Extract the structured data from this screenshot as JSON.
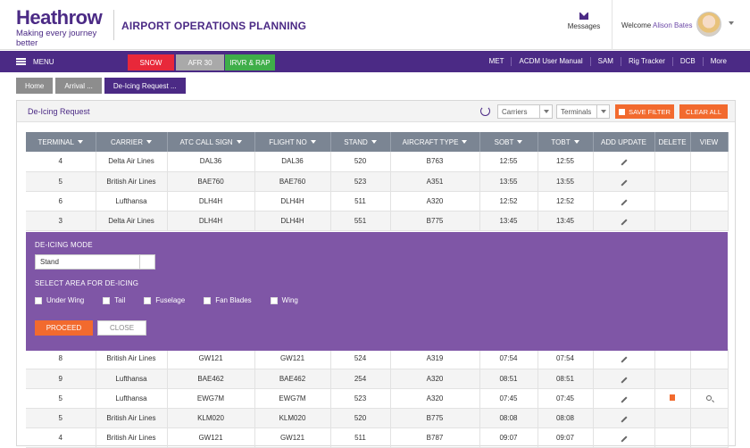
{
  "header": {
    "logo_main": "Heathrow",
    "logo_tagline": "Making every journey better",
    "app_title": "AIRPORT OPERATIONS PLANNING",
    "messages_label": "Messages",
    "welcome_prefix": "Welcome",
    "user_name": "Alison Bates"
  },
  "navbar": {
    "menu_label": "MENU",
    "pills": {
      "snow": "SNOW",
      "afr": "AFR 30",
      "irvr": "IRVR & RAP"
    },
    "links": [
      "MET",
      "ACDM User Manual",
      "SAM",
      "Rig Tracker",
      "DCB",
      "More"
    ]
  },
  "breadcrumb": [
    "Home",
    "Arrival ...",
    "De-Icing Request ..."
  ],
  "panel": {
    "title": "De-Icing Request",
    "carriers_select": "Carriers",
    "terminals_select": "Terminals",
    "save_filter": "SAVE FILTER",
    "clear_all": "CLEAR ALL"
  },
  "table": {
    "columns": [
      "TERMINAL",
      "CARRIER",
      "ATC CALL SIGN",
      "FLIGHT NO",
      "STAND",
      "AIRCRAFT TYPE",
      "SOBT",
      "TOBT",
      "ADD UPDATE",
      "DELETE",
      "VIEW"
    ],
    "rows_top": [
      [
        "4",
        "Delta Air Lines",
        "DAL36",
        "DAL36",
        "520",
        "B763",
        "12:55",
        "12:55"
      ],
      [
        "5",
        "British Air Lines",
        "BAE760",
        "BAE760",
        "523",
        "A351",
        "13:55",
        "13:55"
      ],
      [
        "6",
        "Lufthansa",
        "DLH4H",
        "DLH4H",
        "511",
        "A320",
        "12:52",
        "12:52"
      ],
      [
        "3",
        "Delta Air Lines",
        "DLH4H",
        "DLH4H",
        "551",
        "B775",
        "13:45",
        "13:45"
      ]
    ],
    "rows_bottom": [
      [
        "8",
        "British Air Lines",
        "GW121",
        "GW121",
        "524",
        "A319",
        "07:54",
        "07:54"
      ],
      [
        "9",
        "Lufthansa",
        "BAE462",
        "BAE462",
        "254",
        "A320",
        "08:51",
        "08:51"
      ],
      [
        "5",
        "Lufthansa",
        "EWG7M",
        "EWG7M",
        "523",
        "A320",
        "07:45",
        "07:45"
      ],
      [
        "5",
        "British Air Lines",
        "KLM020",
        "KLM020",
        "520",
        "B775",
        "08:08",
        "08:08"
      ],
      [
        "4",
        "British Air Lines",
        "GW121",
        "GW121",
        "511",
        "B787",
        "09:07",
        "09:07"
      ]
    ]
  },
  "deicing": {
    "mode_label": "DE-ICING MODE",
    "mode_value": "Stand",
    "area_label": "SELECT AREA FOR DE-ICING",
    "areas": [
      "Under Wing",
      "Tail",
      "Fuselage",
      "Fan Blades",
      "Wing"
    ],
    "proceed": "PROCEED",
    "close": "CLOSE"
  },
  "colors": {
    "brand_purple": "#4b2a85",
    "overlay_purple": "#7f56a6",
    "accent_orange": "#f26a2e",
    "snow_red": "#e8283a",
    "irvr_green": "#3fae49"
  }
}
